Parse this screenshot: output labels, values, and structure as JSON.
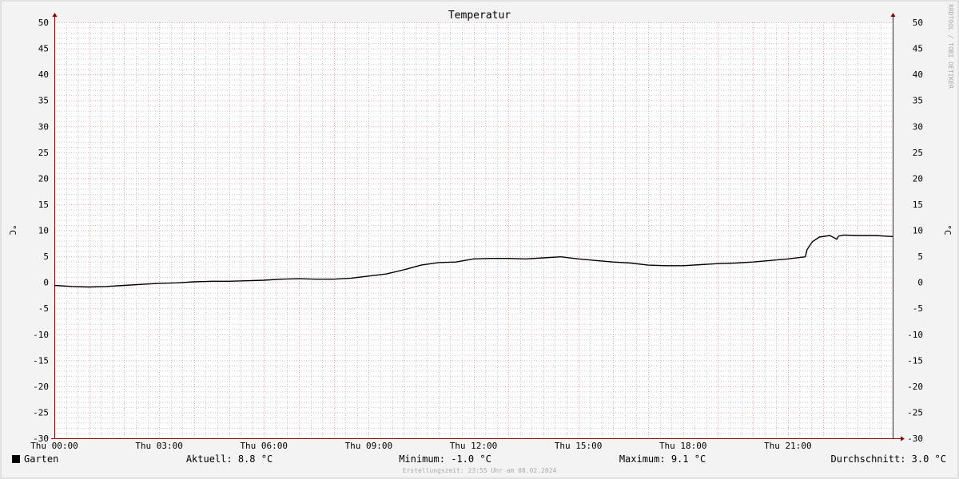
{
  "colors": {
    "background": "#f3f3f3",
    "plot_background": "#ffffff",
    "minor_grid": "#c8c8c8",
    "major_grid": "#e8a8a8",
    "axis": "#8b0000",
    "line": "#000000",
    "watermark": "#aaaaaa"
  },
  "watermark": "RRDTOOL / TOBI OETIKER",
  "footer": "Erstellungszeit: 23:55 Uhr am 08.02.2024",
  "legend": {
    "swatch_color": "#000000",
    "series": "Garten",
    "current": "Aktuell: 8.8 °C",
    "minimum": "Minimum: -1.0 °C",
    "maximum": "Maximum: 9.1 °C",
    "average": "Durchschnitt: 3.0 °C"
  },
  "chart_data": {
    "type": "line",
    "title": "Temperatur",
    "ylabel": "°C",
    "ylabel_right": "°C",
    "xlabel": "",
    "ylim": [
      -30,
      50
    ],
    "xlim": [
      0,
      24
    ],
    "y_ticks": [
      50,
      45,
      40,
      35,
      30,
      25,
      20,
      15,
      10,
      5,
      0,
      -5,
      -10,
      -15,
      -20,
      -25,
      -30
    ],
    "x_ticks": [
      {
        "value": 0,
        "label": "Thu 00:00"
      },
      {
        "value": 3,
        "label": "Thu 03:00"
      },
      {
        "value": 6,
        "label": "Thu 06:00"
      },
      {
        "value": 9,
        "label": "Thu 09:00"
      },
      {
        "value": 12,
        "label": "Thu 12:00"
      },
      {
        "value": 15,
        "label": "Thu 15:00"
      },
      {
        "value": 18,
        "label": "Thu 18:00"
      },
      {
        "value": 21,
        "label": "Thu 21:00"
      }
    ],
    "grid": true,
    "legend_position": "bottom",
    "series": [
      {
        "name": "Garten",
        "color": "#000000",
        "x": [
          0,
          0.5,
          1.0,
          1.5,
          2.0,
          2.5,
          3.0,
          3.5,
          4.0,
          4.5,
          5.0,
          5.5,
          6.0,
          6.5,
          7.0,
          7.5,
          8.0,
          8.5,
          9.0,
          9.5,
          10.0,
          10.5,
          11.0,
          11.5,
          12.0,
          12.5,
          13.0,
          13.5,
          14.0,
          14.5,
          15.0,
          15.5,
          16.0,
          16.5,
          17.0,
          17.5,
          18.0,
          18.5,
          19.0,
          19.5,
          20.0,
          20.5,
          21.0,
          21.5,
          21.55,
          21.7,
          21.9,
          22.2,
          22.4,
          22.45,
          22.6,
          23.0,
          23.5,
          24.0
        ],
        "values": [
          -0.6,
          -0.8,
          -0.9,
          -0.8,
          -0.6,
          -0.4,
          -0.2,
          -0.1,
          0.1,
          0.2,
          0.2,
          0.3,
          0.4,
          0.6,
          0.7,
          0.6,
          0.6,
          0.8,
          1.2,
          1.6,
          2.4,
          3.3,
          3.8,
          3.9,
          4.5,
          4.6,
          4.6,
          4.5,
          4.7,
          4.9,
          4.5,
          4.2,
          3.9,
          3.7,
          3.3,
          3.2,
          3.2,
          3.4,
          3.6,
          3.7,
          3.9,
          4.2,
          4.5,
          4.9,
          6.3,
          7.8,
          8.7,
          9.0,
          8.3,
          8.9,
          9.1,
          9.0,
          9.0,
          8.8
        ]
      }
    ]
  }
}
